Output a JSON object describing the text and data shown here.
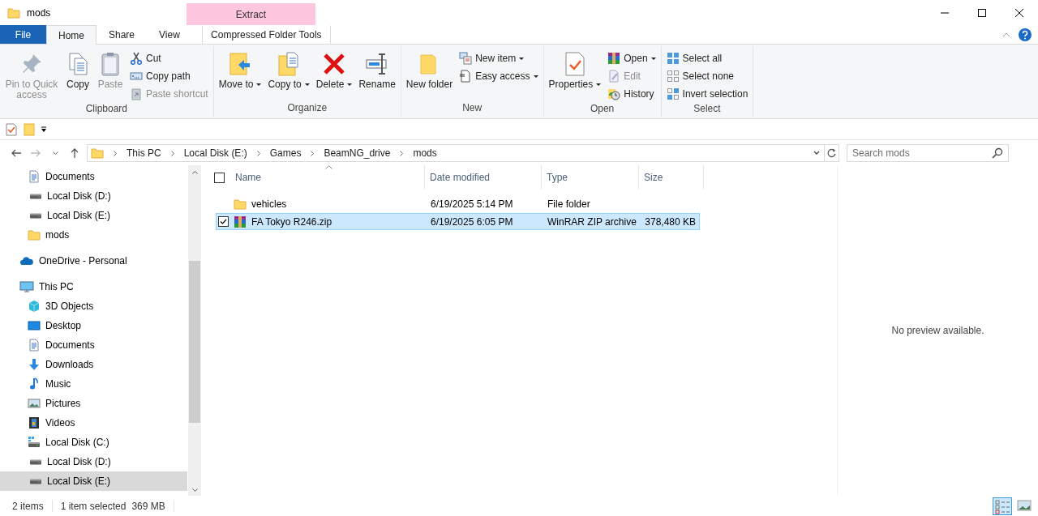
{
  "window": {
    "title": "mods"
  },
  "context_tab_group": {
    "label": "Extract"
  },
  "tabs": [
    {
      "label": "File",
      "kind": "file",
      "selected": false
    },
    {
      "label": "Home",
      "kind": "tab",
      "selected": true
    },
    {
      "label": "Share",
      "kind": "tab",
      "selected": false
    },
    {
      "label": "View",
      "kind": "tab",
      "selected": false
    },
    {
      "label": "Compressed Folder Tools",
      "kind": "context",
      "selected": false
    }
  ],
  "ribbon": {
    "groups": [
      {
        "label": "Clipboard",
        "items": [
          {
            "label": "Pin to Quick access",
            "kind": "large",
            "disabled": true,
            "dropdown": false
          },
          {
            "label": "Copy",
            "kind": "large",
            "disabled": false,
            "dropdown": false
          },
          {
            "label": "Paste",
            "kind": "large",
            "disabled": true,
            "dropdown": false
          },
          {
            "label": "Cut",
            "kind": "small",
            "disabled": false,
            "dropdown": false
          },
          {
            "label": "Copy path",
            "kind": "small",
            "disabled": false,
            "dropdown": false
          },
          {
            "label": "Paste shortcut",
            "kind": "small",
            "disabled": true,
            "dropdown": false
          }
        ]
      },
      {
        "label": "Organize",
        "items": [
          {
            "label": "Move to",
            "kind": "large",
            "disabled": false,
            "dropdown": true
          },
          {
            "label": "Copy to",
            "kind": "large",
            "disabled": false,
            "dropdown": true
          },
          {
            "label": "Delete",
            "kind": "large",
            "disabled": false,
            "dropdown": true
          },
          {
            "label": "Rename",
            "kind": "large",
            "disabled": false,
            "dropdown": false
          }
        ]
      },
      {
        "label": "New",
        "items": [
          {
            "label": "New folder",
            "kind": "large",
            "disabled": false,
            "dropdown": false
          },
          {
            "label": "New item",
            "kind": "small",
            "disabled": false,
            "dropdown": true
          },
          {
            "label": "Easy access",
            "kind": "small",
            "disabled": false,
            "dropdown": true
          }
        ]
      },
      {
        "label": "Open",
        "items": [
          {
            "label": "Properties",
            "kind": "large",
            "disabled": false,
            "dropdown": true
          },
          {
            "label": "Open",
            "kind": "small",
            "disabled": false,
            "dropdown": true
          },
          {
            "label": "Edit",
            "kind": "small",
            "disabled": true,
            "dropdown": false
          },
          {
            "label": "History",
            "kind": "small",
            "disabled": false,
            "dropdown": false
          }
        ]
      },
      {
        "label": "Select",
        "items": [
          {
            "label": "Select all",
            "kind": "small",
            "disabled": false,
            "dropdown": false
          },
          {
            "label": "Select none",
            "kind": "small",
            "disabled": false,
            "dropdown": false
          },
          {
            "label": "Invert selection",
            "kind": "small",
            "disabled": false,
            "dropdown": false
          }
        ]
      }
    ]
  },
  "address": {
    "breadcrumbs": [
      "This PC",
      "Local Disk (E:)",
      "Games",
      "BeamNG_drive",
      "mods"
    ]
  },
  "search": {
    "placeholder": "Search mods"
  },
  "nav": [
    {
      "kind": "group",
      "children": [
        {
          "label": "Documents",
          "kind": "documents",
          "selected": false
        },
        {
          "label": "Local Disk (D:)",
          "kind": "drive",
          "selected": false
        },
        {
          "label": "Local Disk (E:)",
          "kind": "drive",
          "selected": false
        },
        {
          "label": "mods",
          "kind": "folder",
          "selected": false
        }
      ]
    },
    {
      "label": "OneDrive - Personal",
      "kind": "onedrive",
      "selected": false
    },
    {
      "label": "This PC",
      "kind": "pc",
      "selected": false,
      "children": [
        {
          "label": "3D Objects",
          "kind": "objects",
          "selected": false
        },
        {
          "label": "Desktop",
          "kind": "desktop",
          "selected": false
        },
        {
          "label": "Documents",
          "kind": "documents",
          "selected": false
        },
        {
          "label": "Downloads",
          "kind": "downloads",
          "selected": false
        },
        {
          "label": "Music",
          "kind": "music",
          "selected": false
        },
        {
          "label": "Pictures",
          "kind": "pictures",
          "selected": false
        },
        {
          "label": "Videos",
          "kind": "videos",
          "selected": false
        },
        {
          "label": "Local Disk (C:)",
          "kind": "systemdrive",
          "selected": false
        },
        {
          "label": "Local Disk (D:)",
          "kind": "drive",
          "selected": false
        },
        {
          "label": "Local Disk (E:)",
          "kind": "drive",
          "selected": true
        }
      ]
    }
  ],
  "table": {
    "select_all": {
      "checked": false
    },
    "columns": [
      {
        "label": "Name",
        "sorted": true
      },
      {
        "label": "Date modified",
        "sorted": false
      },
      {
        "label": "Type",
        "sorted": false
      },
      {
        "label": "Size",
        "sorted": false
      }
    ],
    "rows": [
      {
        "kind": "folder",
        "name": "vehicles",
        "date": "6/19/2025 5:14 PM",
        "type": "File folder",
        "size": "",
        "selected": false,
        "checked": false
      },
      {
        "kind": "archive",
        "name": "FA Tokyo R246.zip",
        "date": "6/19/2025 6:05 PM",
        "type": "WinRAR ZIP archive",
        "size": "378,480 KB",
        "selected": true,
        "checked": true
      }
    ]
  },
  "preview": {
    "message": "No preview available."
  },
  "status_bar": {
    "item_count": "2 items",
    "selection": "1 item selected",
    "selection_size": "369 MB",
    "views": [
      {
        "kind": "details",
        "selected": true
      },
      {
        "kind": "large_icons",
        "selected": false
      }
    ]
  }
}
